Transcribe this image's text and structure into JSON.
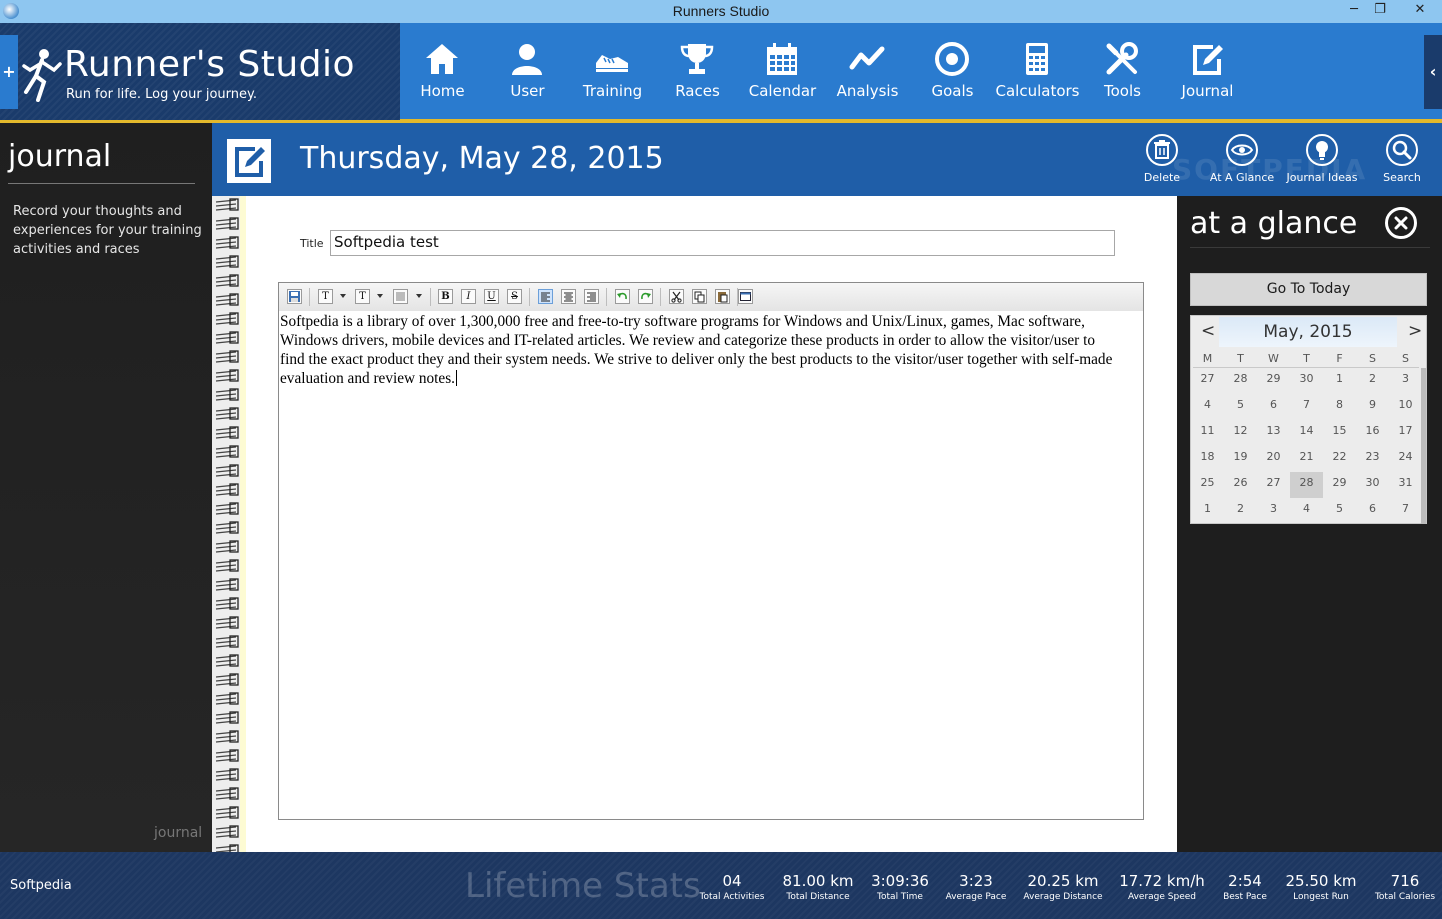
{
  "window": {
    "title": "Runners Studio",
    "minimize_glyph": "─",
    "maximize_glyph": "❐",
    "close_glyph": "✕"
  },
  "brand": {
    "name": "Runner's Studio",
    "tagline": "Run for life. Log your journey.",
    "plus_glyph": "+",
    "colors": {
      "header": "#2a7bcf",
      "brand_bg": "#1a3b6b",
      "accent_line": "#e3b92c"
    }
  },
  "nav": {
    "items": [
      {
        "label": "Home",
        "icon": "home-icon"
      },
      {
        "label": "User",
        "icon": "user-icon"
      },
      {
        "label": "Training",
        "icon": "shoe-icon"
      },
      {
        "label": "Races",
        "icon": "trophy-icon"
      },
      {
        "label": "Calendar",
        "icon": "calendar-icon"
      },
      {
        "label": "Analysis",
        "icon": "analysis-icon"
      },
      {
        "label": "Goals",
        "icon": "target-icon"
      },
      {
        "label": "Calculators",
        "icon": "calculator-icon"
      },
      {
        "label": "Tools",
        "icon": "tools-icon"
      },
      {
        "label": "Journal",
        "icon": "journal-icon"
      }
    ],
    "collapse_glyph": "‹"
  },
  "sidebar": {
    "title": "journal",
    "description": "Record your thoughts and experiences for your training activities and races",
    "footer_label": "journal"
  },
  "datebar": {
    "date": "Thursday, May 28, 2015",
    "watermark": "SOFTPEDIA",
    "actions": [
      {
        "label": "Delete",
        "icon": "trash-icon"
      },
      {
        "label": "At A Glance",
        "icon": "eye-icon"
      },
      {
        "label": "Journal Ideas",
        "icon": "lightbulb-icon"
      },
      {
        "label": "Search",
        "icon": "search-icon"
      }
    ]
  },
  "entry": {
    "title_label": "Title",
    "title_value": "Softpedia test",
    "body": "Softpedia is a library of over 1,300,000 free and free-to-try software programs for Windows and Unix/Linux, games, Mac software, Windows drivers, mobile devices and IT-related articles. We review and categorize these products in order to allow the visitor/user to find the exact product they and their system needs. We strive to deliver only the best products to the visitor/user together with self-made evaluation and review notes.",
    "toolbar": {
      "bold": "B",
      "italic": "I",
      "underline": "U",
      "strike": "S",
      "font": "T",
      "size": "T"
    }
  },
  "glance": {
    "title": "at a glance",
    "go_today": "Go To Today",
    "calendar": {
      "prev": "<",
      "next": ">",
      "month_title": "May, 2015",
      "dows": [
        "M",
        "T",
        "W",
        "T",
        "F",
        "S",
        "S"
      ],
      "weeks": [
        [
          "27",
          "28",
          "29",
          "30",
          "1",
          "2",
          "3"
        ],
        [
          "4",
          "5",
          "6",
          "7",
          "8",
          "9",
          "10"
        ],
        [
          "11",
          "12",
          "13",
          "14",
          "15",
          "16",
          "17"
        ],
        [
          "18",
          "19",
          "20",
          "21",
          "22",
          "23",
          "24"
        ],
        [
          "25",
          "26",
          "27",
          "28",
          "29",
          "30",
          "31"
        ],
        [
          "1",
          "2",
          "3",
          "4",
          "5",
          "6",
          "7"
        ]
      ],
      "selected_day": "28"
    }
  },
  "footer": {
    "user": "Softpedia",
    "lifetime_title": "Lifetime Stats",
    "stats": [
      {
        "value": "04",
        "label": "Total Activities"
      },
      {
        "value": "81.00 km",
        "label": "Total Distance"
      },
      {
        "value": "3:09:36",
        "label": "Total Time"
      },
      {
        "value": "3:23",
        "label": "Average Pace"
      },
      {
        "value": "20.25 km",
        "label": "Average Distance"
      },
      {
        "value": "17.72 km/h",
        "label": "Average Speed"
      },
      {
        "value": "2:54",
        "label": "Best Pace"
      },
      {
        "value": "25.50 km",
        "label": "Longest Run"
      },
      {
        "value": "716",
        "label": "Total Calories"
      }
    ]
  }
}
